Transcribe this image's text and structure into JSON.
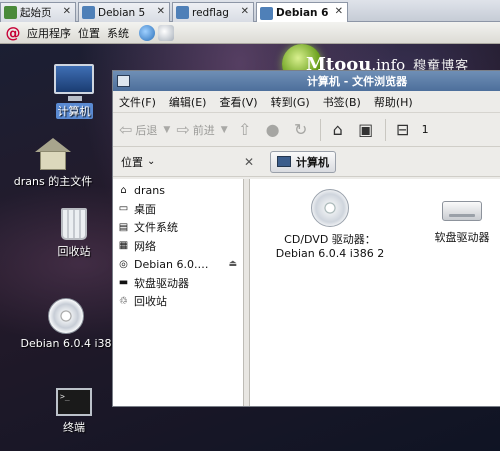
{
  "vm_tabs": [
    {
      "label": "起始页",
      "active": false
    },
    {
      "label": "Debian 5",
      "active": false
    },
    {
      "label": "redflag",
      "active": false
    },
    {
      "label": "Debian 6",
      "active": true
    }
  ],
  "panel": {
    "menus": [
      "应用程序",
      "位置",
      "系统"
    ]
  },
  "desktop": {
    "logo": {
      "brand": "Mtoou",
      "suffix": ".info",
      "tagline": "穆童博客"
    },
    "icons": [
      {
        "label": "计算机",
        "icon": "computer-icon",
        "selected": true
      },
      {
        "label": "drans 的主文件",
        "icon": "home-folder-icon",
        "selected": false
      },
      {
        "label": "回收站",
        "icon": "trash-icon",
        "selected": false
      },
      {
        "label": "Debian 6.0.4 i38",
        "icon": "cd-disc-icon",
        "selected": false
      },
      {
        "label": "终端",
        "icon": "terminal-icon",
        "selected": false
      }
    ]
  },
  "window": {
    "title": "计算机 - 文件浏览器",
    "menu": [
      "文件(F)",
      "编辑(E)",
      "查看(V)",
      "转到(G)",
      "书签(B)",
      "帮助(H)"
    ],
    "toolbar": {
      "back": "后退",
      "forward": "前进",
      "zoom_value": "1"
    },
    "places_label": "位置",
    "breadcrumb": "计算机",
    "sidebar": [
      {
        "label": "drans",
        "icon": "home-folder-icon"
      },
      {
        "label": "桌面",
        "icon": "desktop-folder-icon"
      },
      {
        "label": "文件系统",
        "icon": "filesystem-icon"
      },
      {
        "label": "网络",
        "icon": "network-icon"
      },
      {
        "label": "Debian 6.0.…",
        "icon": "cd-disc-icon",
        "eject": true
      },
      {
        "label": "软盘驱动器",
        "icon": "floppy-drive-icon"
      },
      {
        "label": "回收站",
        "icon": "trash-icon"
      }
    ],
    "items": [
      {
        "line1": "CD/DVD 驱动器：",
        "line2": "Debian 6.0.4 i386 2",
        "icon": "cd-disc-icon"
      },
      {
        "line1": "软盘驱动器",
        "line2": "",
        "icon": "floppy-drive-icon"
      }
    ]
  }
}
